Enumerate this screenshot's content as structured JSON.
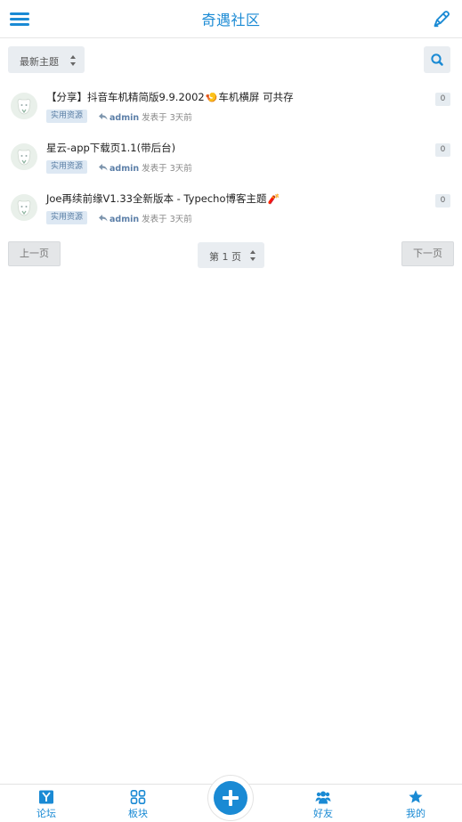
{
  "header": {
    "title": "奇遇社区",
    "menu_icon": "hamburger-menu-icon",
    "edit_icon": "pen-icon",
    "accent_color": "#1a8ad4"
  },
  "toolbar": {
    "sort_selected": "最新主题",
    "search_icon": "search-icon"
  },
  "topics": [
    {
      "title_before": "【分享】抖音车机精简版9.9.2002",
      "emoji": "🍤",
      "title_after": "车机横屏 可共存",
      "tag": "实用资源",
      "author": "admin",
      "time": "发表于 3天前",
      "replies": "0"
    },
    {
      "title_before": "星云-app下载页1.1(带后台)",
      "emoji": "",
      "title_after": "",
      "tag": "实用资源",
      "author": "admin",
      "time": "发表于 3天前",
      "replies": "0"
    },
    {
      "title_before": "Joe再续前缘V1.33全新版本 - Typecho博客主题",
      "emoji": "🧨",
      "title_after": "",
      "tag": "实用资源",
      "author": "admin",
      "time": "发表于 3天前",
      "replies": "0"
    }
  ],
  "pagination": {
    "prev_label": "上一页",
    "page_selected": "第 1 页",
    "next_label": "下一页"
  },
  "bottom_nav": {
    "forum_label": "论坛",
    "boards_label": "板块",
    "friends_label": "好友",
    "mine_label": "我的"
  }
}
